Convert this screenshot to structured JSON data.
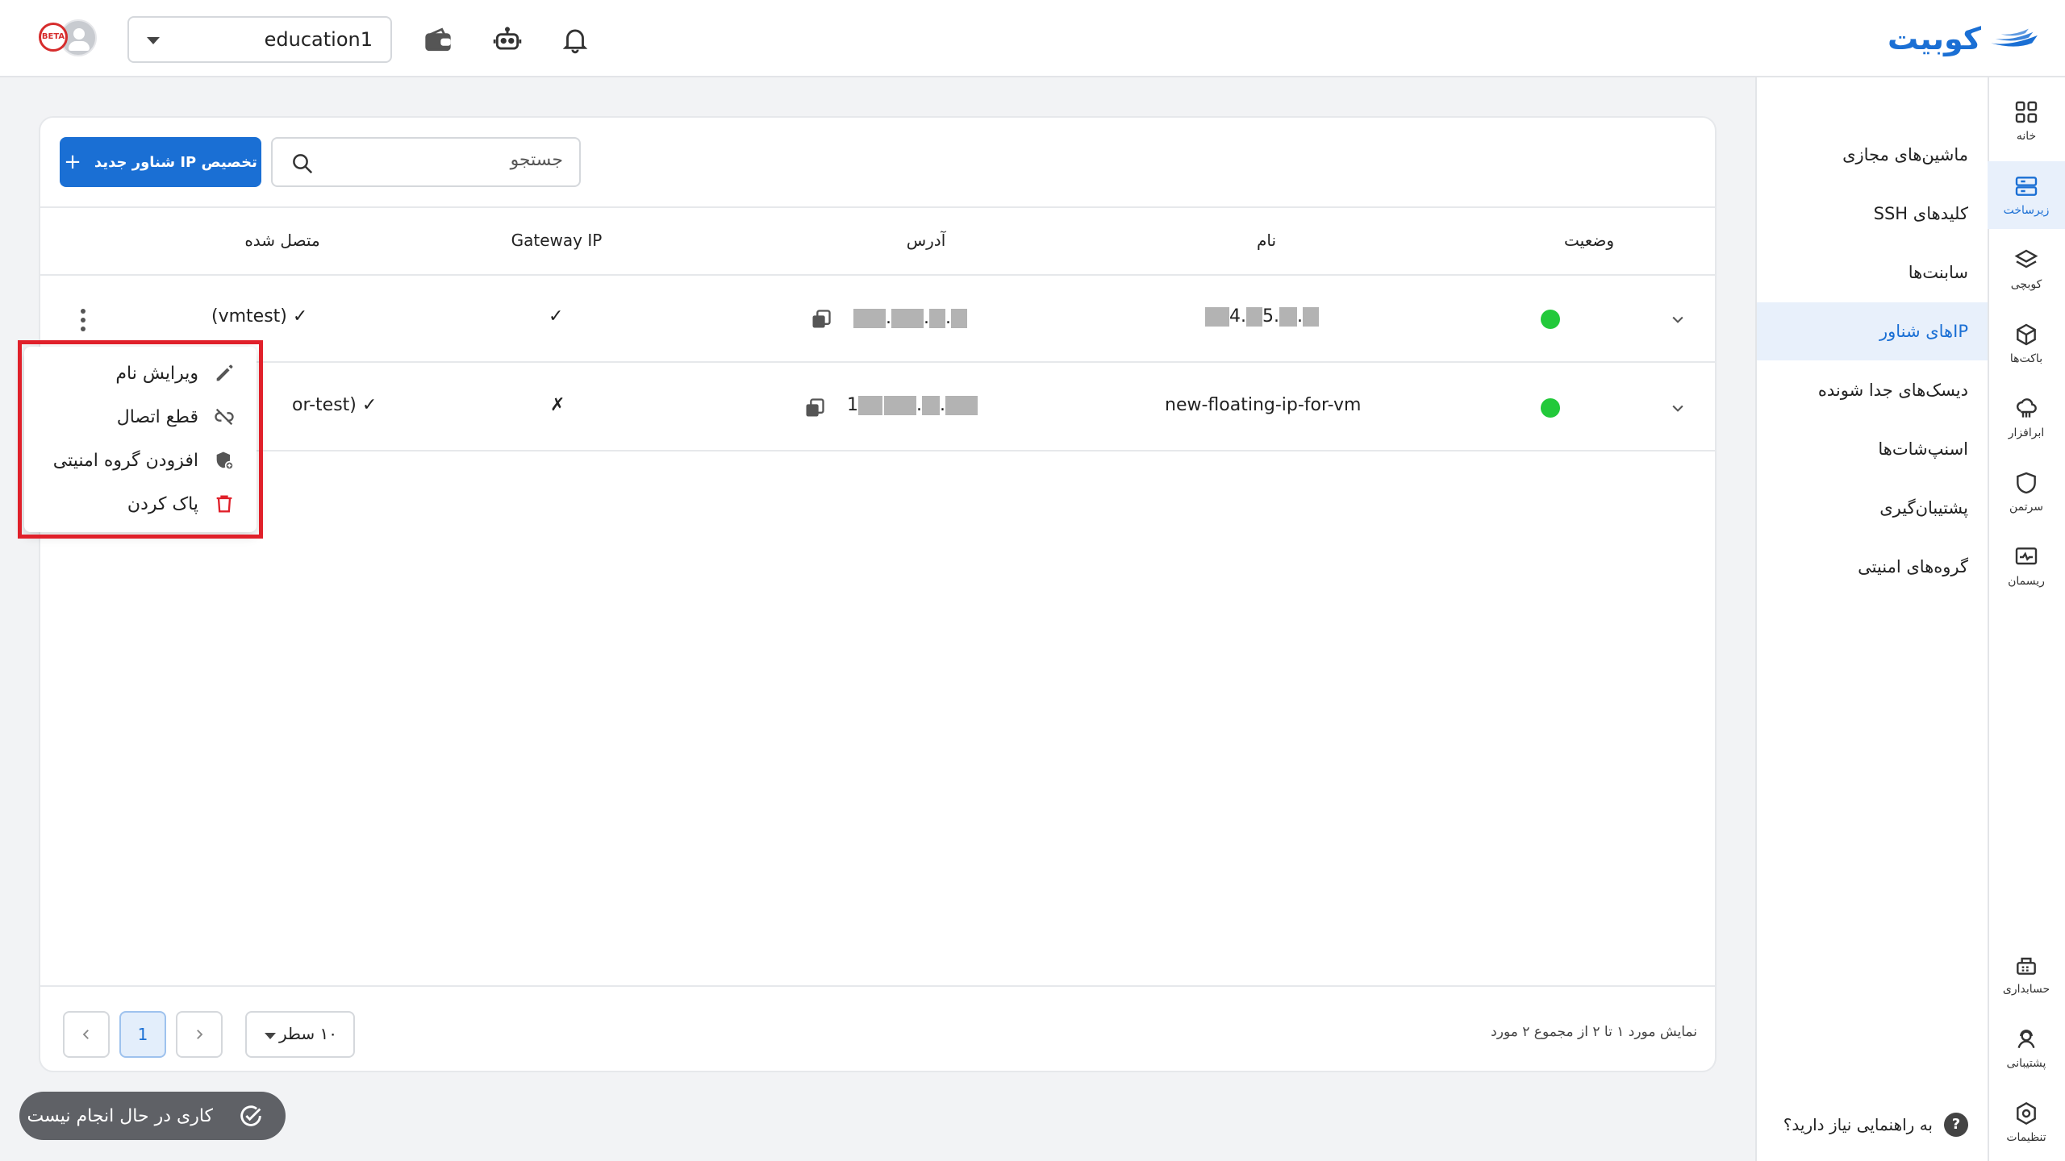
{
  "header": {
    "logo_text": "کوبیت",
    "project_value": "education1",
    "icons": [
      "bell-icon",
      "robot-icon",
      "wallet-icon"
    ],
    "avatar_badge": "BETA"
  },
  "rail": {
    "items": [
      {
        "label": "خانه",
        "icon": "grid-icon"
      },
      {
        "label": "زیرساخت",
        "icon": "server-icon",
        "active": true
      },
      {
        "label": "کوبچی",
        "icon": "layers-icon"
      },
      {
        "label": "باکت‌ها",
        "icon": "box-icon"
      },
      {
        "label": "ابرافزار",
        "icon": "cloud-app-icon"
      },
      {
        "label": "سرتمن",
        "icon": "shield-icon"
      },
      {
        "label": "ریسمان",
        "icon": "monitor-icon"
      }
    ],
    "bottom_items": [
      {
        "label": "حسابداری",
        "icon": "billing-icon"
      },
      {
        "label": "پشتیبانی",
        "icon": "support-icon"
      },
      {
        "label": "تنظیمات",
        "icon": "settings-icon"
      }
    ]
  },
  "submenu": {
    "items": [
      {
        "label": "ماشین‌های مجازی"
      },
      {
        "label": "کلیدهای SSH"
      },
      {
        "label": "سابنت‌ها"
      },
      {
        "label": "IPهای شناور",
        "active": true
      },
      {
        "label": "دیسک‌های جدا شونده"
      },
      {
        "label": "اسنپ‌شات‌ها"
      },
      {
        "label": "پشتیبان‌گیری"
      },
      {
        "label": "گروه‌های امنیتی"
      }
    ],
    "help_label": "به راهنمایی نیاز دارید؟",
    "help_icon_glyph": "?"
  },
  "toolbar": {
    "add_label": "تخصیص IP شناور جدید",
    "add_icon": "+",
    "search_placeholder": "جستجو"
  },
  "table": {
    "columns": {
      "status": "وضعیت",
      "name": "نام",
      "address": "آدرس",
      "gateway": "Gateway IP",
      "attached": "متصل شده"
    },
    "rows": [
      {
        "status": "active",
        "name_parts": [
          "4.",
          "5.",
          "."
        ],
        "address_parts": [
          ".",
          ".",
          "."
        ],
        "gateway": "✓",
        "attached": "(vmtest) ✓"
      },
      {
        "status": "active",
        "name": "new-floating-ip-for-vm",
        "address_parts": [
          "1",
          ".",
          "."
        ],
        "gateway": "✗",
        "attached": "or-test) ✓"
      }
    ]
  },
  "context_menu": {
    "items": [
      {
        "label": "ویرایش نام",
        "icon": "pencil-icon"
      },
      {
        "label": "قطع اتصال",
        "icon": "unlink-icon"
      },
      {
        "label": "افزودن گروه امنیتی",
        "icon": "shield-add-icon"
      },
      {
        "label": "پاک کردن",
        "icon": "trash-icon",
        "color": "#e0202a"
      }
    ]
  },
  "footer": {
    "summary": "نمایش مورد ۱ تا ۲ از مجموع ۲ مورد",
    "rows_per_page": "۱۰ سطر",
    "current_page": "1"
  },
  "toast": {
    "text": "کاری در حال انجام نیست"
  },
  "colors": {
    "accent": "#1a6fd4",
    "status_active": "#22c93a",
    "danger": "#e0202a"
  }
}
